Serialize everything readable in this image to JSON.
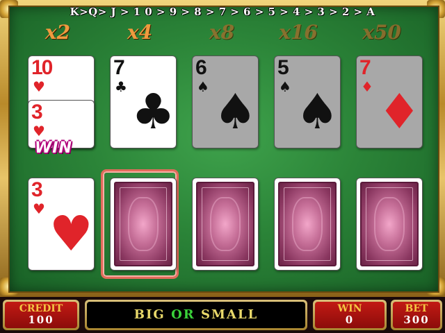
{
  "rank_order": "K>Q> J > 1 0 > 9 > 8 > 7 > 6 > 5 > 4 > 3 > 2 > A",
  "multipliers": [
    {
      "label": "x2",
      "state": "active"
    },
    {
      "label": "x4",
      "state": "active"
    },
    {
      "label": "x8",
      "state": "dim"
    },
    {
      "label": "x16",
      "state": "dim"
    },
    {
      "label": "x50",
      "state": "dim"
    }
  ],
  "top_row": [
    {
      "rank": "10",
      "suit": "♥",
      "color": "red",
      "state": "face"
    },
    {
      "rank": "7",
      "suit": "♣",
      "color": "black",
      "state": "face"
    },
    {
      "rank": "6",
      "suit": "♠",
      "color": "black",
      "state": "dimmed"
    },
    {
      "rank": "5",
      "suit": "♠",
      "color": "black",
      "state": "dimmed"
    },
    {
      "rank": "7",
      "suit": "♦",
      "color": "red",
      "state": "dimmed"
    }
  ],
  "stacked_card": {
    "rank": "3",
    "suit": "♥",
    "color": "red"
  },
  "win_tag": "WIN",
  "bottom_row": [
    {
      "rank": "3",
      "suit": "♥",
      "color": "red",
      "state": "face"
    },
    {
      "state": "back",
      "selected": true
    },
    {
      "state": "back"
    },
    {
      "state": "back"
    },
    {
      "state": "back"
    }
  ],
  "status_bar": {
    "credit_label": "CREDIT",
    "credit_value": "100",
    "message_big": "BIG",
    "message_or": "OR",
    "message_small": "SMALL",
    "win_label": "WIN",
    "win_value": "0",
    "bet_label": "BET",
    "bet_value": "300"
  },
  "colors": {
    "felt": "#2b8438",
    "multiplier_active": "#f09a3e",
    "card_red": "#e0242a",
    "panel_red": "#c21a14",
    "gold": "#d4a336"
  }
}
